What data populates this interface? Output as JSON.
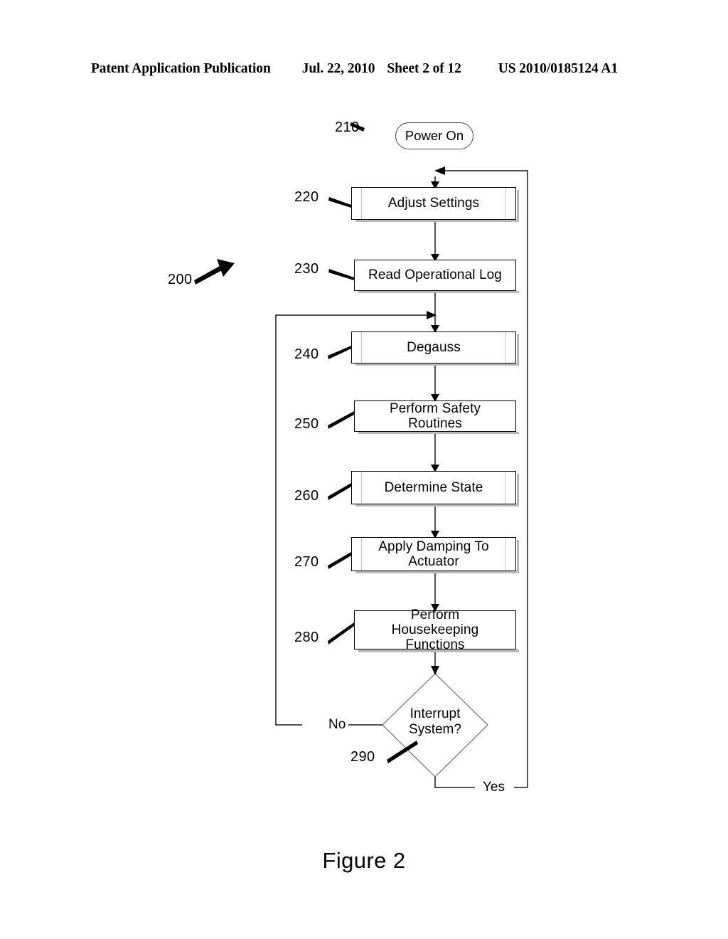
{
  "header": {
    "publication": "Patent Application Publication",
    "date": "Jul. 22, 2010",
    "sheet": "Sheet 2 of 12",
    "doc_number": "US 2010/0185124 A1"
  },
  "figure": {
    "caption": "Figure 2",
    "diagram_ref": "200"
  },
  "nodes": {
    "terminal": {
      "ref": "210",
      "label": "Power On"
    },
    "step220": {
      "ref": "220",
      "label": "Adjust Settings"
    },
    "step230": {
      "ref": "230",
      "label": "Read Operational Log"
    },
    "step240": {
      "ref": "240",
      "label": "Degauss"
    },
    "step250": {
      "ref": "250",
      "label": "Perform Safety Routines"
    },
    "step260": {
      "ref": "260",
      "label": "Determine State"
    },
    "step270": {
      "ref": "270",
      "label_line1": "Apply Damping To",
      "label_line2": "Actuator"
    },
    "step280": {
      "ref": "280",
      "label_line1": "Perform Housekeeping",
      "label_line2": "Functions"
    },
    "decision290": {
      "ref": "290",
      "label_line1": "Interrupt",
      "label_line2": "System?"
    }
  },
  "branches": {
    "no": "No",
    "yes": "Yes"
  },
  "colors": {
    "ink": "#000000",
    "line": "#1a1a1a",
    "faint_rule": "#c9c9c9",
    "shadow": "#b9b9b9",
    "page": "#ffffff"
  }
}
